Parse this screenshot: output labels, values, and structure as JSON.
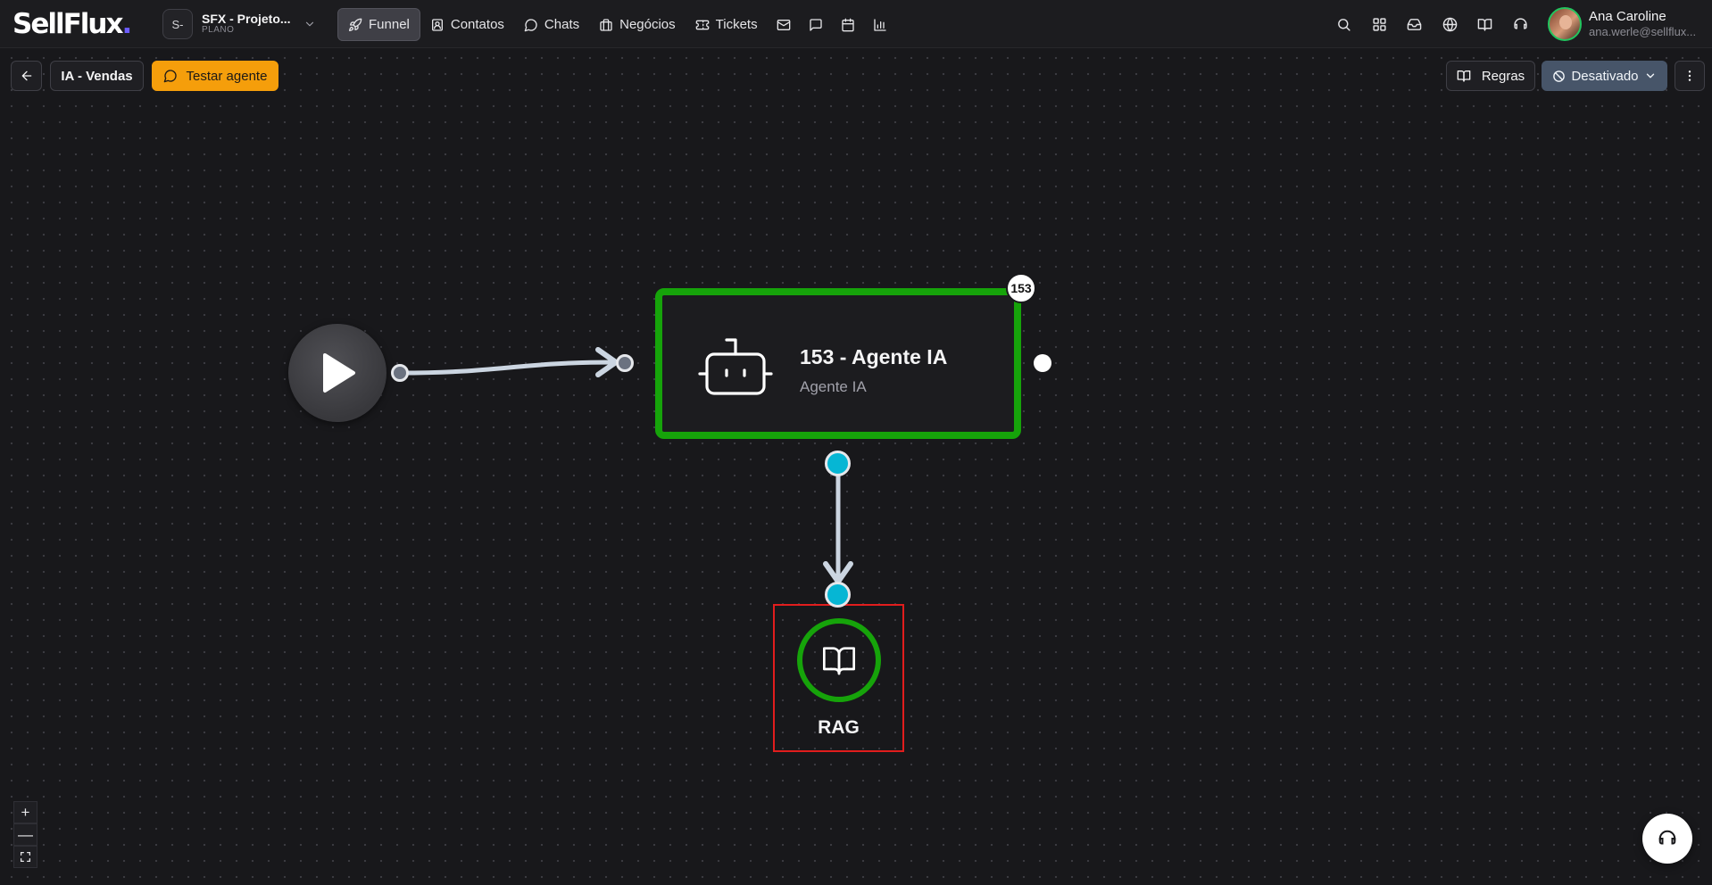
{
  "brand": {
    "logo_text": "SellFlux",
    "logo_dot": "."
  },
  "project": {
    "badge": "S-",
    "name": "SFX - Projeto...",
    "plan": "PLANO"
  },
  "nav": {
    "items": [
      {
        "label": "Funnel",
        "icon": "rocket-icon",
        "active": true
      },
      {
        "label": "Contatos",
        "icon": "contacts-icon"
      },
      {
        "label": "Chats",
        "icon": "chat-bubble-icon"
      },
      {
        "label": "Negócios",
        "icon": "briefcase-icon"
      },
      {
        "label": "Tickets",
        "icon": "ticket-icon"
      }
    ],
    "icon_items": [
      "mail-icon",
      "message-square-icon",
      "calendar-icon",
      "bar-chart-icon"
    ]
  },
  "header_icons": [
    "search-icon",
    "apps-grid-icon",
    "inbox-icon",
    "globe-icon",
    "book-icon",
    "headset-icon"
  ],
  "user": {
    "name": "Ana Caroline",
    "email": "ana.werle@sellflux..."
  },
  "toolbar": {
    "title": "IA - Vendas",
    "test_label": "Testar agente",
    "rules_label": "Regras",
    "status_label": "Desativado"
  },
  "canvas": {
    "agent_node": {
      "title": "153 - Agente IA",
      "subtitle": "Agente IA",
      "badge": "153"
    },
    "rag_node": {
      "label": "RAG"
    }
  },
  "zoom": {
    "plus": "+",
    "minus": "—"
  },
  "colors": {
    "node_border": "#16a30a",
    "test_button": "#f59e0b",
    "status_button": "#475569",
    "handle_cyan": "#06b6d4",
    "highlight_frame": "#e11d1d"
  }
}
